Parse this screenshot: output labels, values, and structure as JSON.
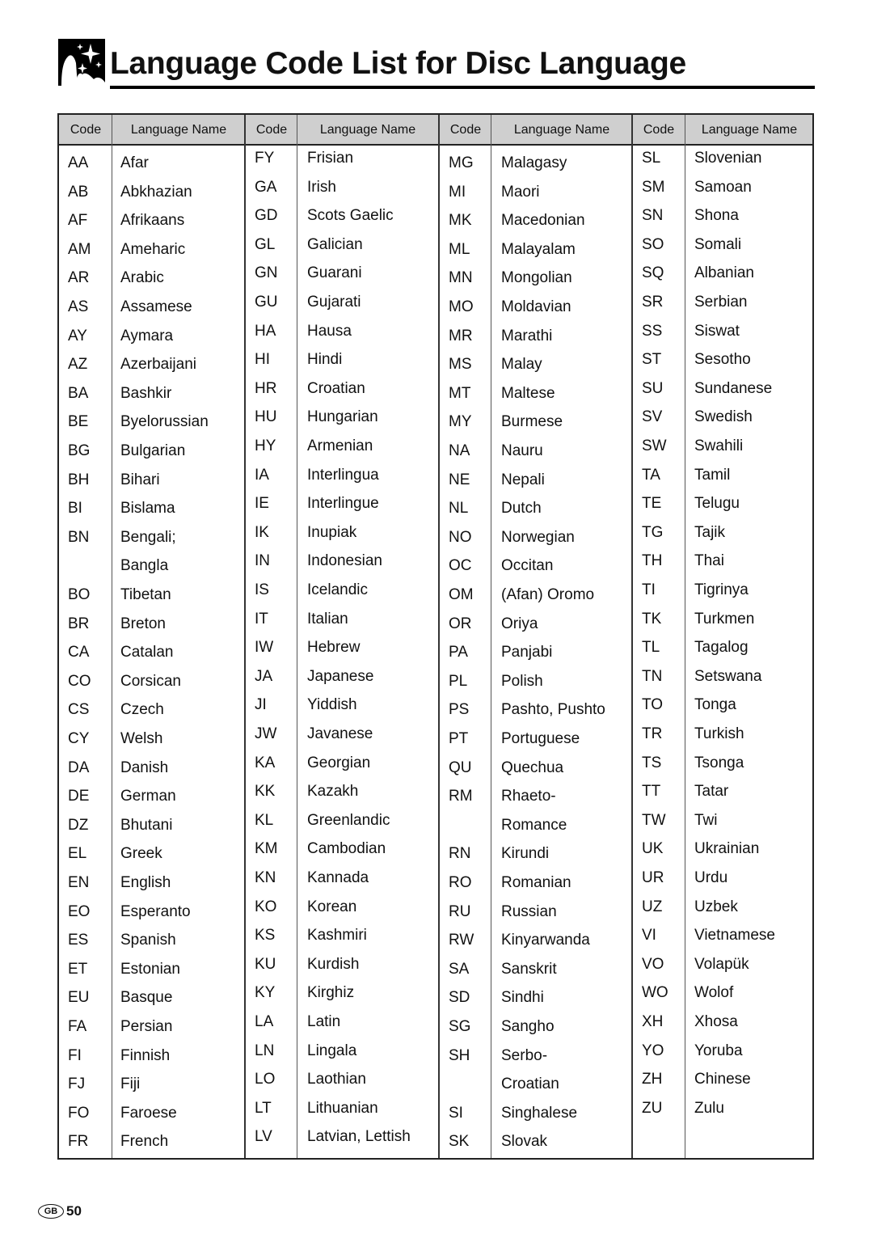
{
  "page": {
    "title": "Language Code List for Disc Language",
    "logo_icon": "sparkle-castle-icon",
    "footer": {
      "region_badge": "GB",
      "page_number": "50"
    }
  },
  "table": {
    "headers": [
      "Code",
      "Language Name",
      "Code",
      "Language Name",
      "Code",
      "Language Name",
      "Code",
      "Language Name"
    ],
    "columns": [
      {
        "rows": [
          {
            "code": "AA",
            "name": "Afar"
          },
          {
            "code": "AB",
            "name": "Abkhazian"
          },
          {
            "code": "AF",
            "name": "Afrikaans"
          },
          {
            "code": "AM",
            "name": "Ameharic"
          },
          {
            "code": "AR",
            "name": "Arabic"
          },
          {
            "code": "AS",
            "name": "Assamese"
          },
          {
            "code": "AY",
            "name": "Aymara"
          },
          {
            "code": "AZ",
            "name": "Azerbaijani"
          },
          {
            "code": "BA",
            "name": "Bashkir"
          },
          {
            "code": "BE",
            "name": "Byelorussian"
          },
          {
            "code": "BG",
            "name": "Bulgarian"
          },
          {
            "code": "BH",
            "name": "Bihari"
          },
          {
            "code": "BI",
            "name": "Bislama"
          },
          {
            "code": "BN",
            "name": "Bengali;"
          },
          {
            "code": "",
            "name": "Bangla"
          },
          {
            "code": "BO",
            "name": "Tibetan"
          },
          {
            "code": "BR",
            "name": "Breton"
          },
          {
            "code": "CA",
            "name": "Catalan"
          },
          {
            "code": "CO",
            "name": "Corsican"
          },
          {
            "code": "CS",
            "name": "Czech"
          },
          {
            "code": "CY",
            "name": "Welsh"
          },
          {
            "code": "DA",
            "name": "Danish"
          },
          {
            "code": "DE",
            "name": "German"
          },
          {
            "code": "DZ",
            "name": "Bhutani"
          },
          {
            "code": "EL",
            "name": "Greek"
          },
          {
            "code": "EN",
            "name": "English"
          },
          {
            "code": "EO",
            "name": "Esperanto"
          },
          {
            "code": "ES",
            "name": "Spanish"
          },
          {
            "code": "ET",
            "name": "Estonian"
          },
          {
            "code": "EU",
            "name": "Basque"
          },
          {
            "code": "FA",
            "name": "Persian"
          },
          {
            "code": "FI",
            "name": "Finnish"
          },
          {
            "code": "FJ",
            "name": "Fiji"
          },
          {
            "code": "FO",
            "name": "Faroese"
          },
          {
            "code": "FR",
            "name": "French"
          }
        ]
      },
      {
        "rows": [
          {
            "code": "FY",
            "name": "Frisian"
          },
          {
            "code": "GA",
            "name": "Irish"
          },
          {
            "code": "GD",
            "name": "Scots Gaelic"
          },
          {
            "code": "GL",
            "name": "Galician"
          },
          {
            "code": "GN",
            "name": "Guarani"
          },
          {
            "code": "GU",
            "name": "Gujarati"
          },
          {
            "code": "HA",
            "name": "Hausa"
          },
          {
            "code": "HI",
            "name": "Hindi"
          },
          {
            "code": "HR",
            "name": "Croatian"
          },
          {
            "code": "HU",
            "name": "Hungarian"
          },
          {
            "code": "HY",
            "name": "Armenian"
          },
          {
            "code": "IA",
            "name": "Interlingua"
          },
          {
            "code": "IE",
            "name": "Interlingue"
          },
          {
            "code": "IK",
            "name": "Inupiak"
          },
          {
            "code": "IN",
            "name": "Indonesian"
          },
          {
            "code": "IS",
            "name": "Icelandic"
          },
          {
            "code": "IT",
            "name": "Italian"
          },
          {
            "code": "IW",
            "name": "Hebrew"
          },
          {
            "code": "JA",
            "name": "Japanese"
          },
          {
            "code": "JI",
            "name": "Yiddish"
          },
          {
            "code": "JW",
            "name": "Javanese"
          },
          {
            "code": "KA",
            "name": "Georgian"
          },
          {
            "code": "KK",
            "name": "Kazakh"
          },
          {
            "code": "KL",
            "name": "Greenlandic"
          },
          {
            "code": "KM",
            "name": "Cambodian"
          },
          {
            "code": "KN",
            "name": "Kannada"
          },
          {
            "code": "KO",
            "name": "Korean"
          },
          {
            "code": "KS",
            "name": "Kashmiri"
          },
          {
            "code": "KU",
            "name": "Kurdish"
          },
          {
            "code": "KY",
            "name": "Kirghiz"
          },
          {
            "code": "LA",
            "name": "Latin"
          },
          {
            "code": "LN",
            "name": "Lingala"
          },
          {
            "code": "LO",
            "name": "Laothian"
          },
          {
            "code": "LT",
            "name": "Lithuanian"
          },
          {
            "code": "LV",
            "name": "Latvian, Lettish"
          }
        ]
      },
      {
        "rows": [
          {
            "code": "MG",
            "name": "Malagasy"
          },
          {
            "code": "MI",
            "name": "Maori"
          },
          {
            "code": "MK",
            "name": "Macedonian"
          },
          {
            "code": "ML",
            "name": "Malayalam"
          },
          {
            "code": "MN",
            "name": "Mongolian"
          },
          {
            "code": "MO",
            "name": "Moldavian"
          },
          {
            "code": "MR",
            "name": "Marathi"
          },
          {
            "code": "MS",
            "name": "Malay"
          },
          {
            "code": "MT",
            "name": "Maltese"
          },
          {
            "code": "MY",
            "name": "Burmese"
          },
          {
            "code": "NA",
            "name": "Nauru"
          },
          {
            "code": "NE",
            "name": "Nepali"
          },
          {
            "code": "NL",
            "name": "Dutch"
          },
          {
            "code": "NO",
            "name": "Norwegian"
          },
          {
            "code": "OC",
            "name": "Occitan"
          },
          {
            "code": "OM",
            "name": "(Afan) Oromo"
          },
          {
            "code": "OR",
            "name": "Oriya"
          },
          {
            "code": "PA",
            "name": "Panjabi"
          },
          {
            "code": "PL",
            "name": "Polish"
          },
          {
            "code": "PS",
            "name": "Pashto, Pushto"
          },
          {
            "code": "PT",
            "name": "Portuguese"
          },
          {
            "code": "QU",
            "name": "Quechua"
          },
          {
            "code": "RM",
            "name": "Rhaeto-"
          },
          {
            "code": "",
            "name": "Romance"
          },
          {
            "code": "RN",
            "name": "Kirundi"
          },
          {
            "code": "RO",
            "name": "Romanian"
          },
          {
            "code": "RU",
            "name": "Russian"
          },
          {
            "code": "RW",
            "name": "Kinyarwanda"
          },
          {
            "code": "SA",
            "name": "Sanskrit"
          },
          {
            "code": "SD",
            "name": "Sindhi"
          },
          {
            "code": "SG",
            "name": "Sangho"
          },
          {
            "code": "SH",
            "name": "Serbo-"
          },
          {
            "code": "",
            "name": "Croatian"
          },
          {
            "code": "SI",
            "name": "Singhalese"
          },
          {
            "code": "SK",
            "name": "Slovak"
          }
        ]
      },
      {
        "rows": [
          {
            "code": "SL",
            "name": "Slovenian"
          },
          {
            "code": "SM",
            "name": "Samoan"
          },
          {
            "code": "SN",
            "name": "Shona"
          },
          {
            "code": "SO",
            "name": "Somali"
          },
          {
            "code": "SQ",
            "name": "Albanian"
          },
          {
            "code": "SR",
            "name": "Serbian"
          },
          {
            "code": "SS",
            "name": "Siswat"
          },
          {
            "code": "ST",
            "name": "Sesotho"
          },
          {
            "code": "SU",
            "name": "Sundanese"
          },
          {
            "code": "SV",
            "name": "Swedish"
          },
          {
            "code": "SW",
            "name": "Swahili"
          },
          {
            "code": "TA",
            "name": "Tamil"
          },
          {
            "code": "TE",
            "name": "Telugu"
          },
          {
            "code": "TG",
            "name": "Tajik"
          },
          {
            "code": "TH",
            "name": "Thai"
          },
          {
            "code": "TI",
            "name": "Tigrinya"
          },
          {
            "code": "TK",
            "name": "Turkmen"
          },
          {
            "code": "TL",
            "name": "Tagalog"
          },
          {
            "code": "TN",
            "name": "Setswana"
          },
          {
            "code": "TO",
            "name": "Tonga"
          },
          {
            "code": "TR",
            "name": "Turkish"
          },
          {
            "code": "TS",
            "name": "Tsonga"
          },
          {
            "code": "TT",
            "name": "Tatar"
          },
          {
            "code": "TW",
            "name": "Twi"
          },
          {
            "code": "UK",
            "name": "Ukrainian"
          },
          {
            "code": "UR",
            "name": "Urdu"
          },
          {
            "code": "UZ",
            "name": "Uzbek"
          },
          {
            "code": "VI",
            "name": "Vietnamese"
          },
          {
            "code": "VO",
            "name": "Volapük"
          },
          {
            "code": "WO",
            "name": "Wolof"
          },
          {
            "code": "XH",
            "name": "Xhosa"
          },
          {
            "code": "YO",
            "name": "Yoruba"
          },
          {
            "code": "ZH",
            "name": "Chinese"
          },
          {
            "code": "ZU",
            "name": "Zulu"
          }
        ]
      }
    ]
  }
}
